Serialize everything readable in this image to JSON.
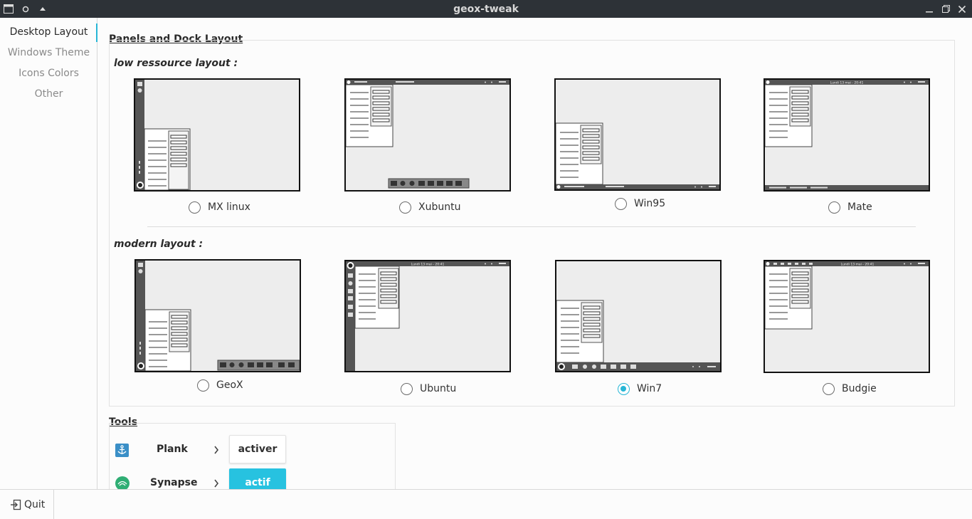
{
  "window": {
    "title": "geox-tweak"
  },
  "sidebar": {
    "items": [
      {
        "label": "Desktop Layout",
        "active": true
      },
      {
        "label": "Windows Theme",
        "active": false
      },
      {
        "label": "Icons Colors",
        "active": false
      },
      {
        "label": "Other",
        "active": false
      }
    ]
  },
  "panels": {
    "title": "Panels and Dock Layout",
    "low_label": "low ressource layout :",
    "modern_label": "modern layout :",
    "low_options": [
      {
        "label": "MX linux",
        "selected": false
      },
      {
        "label": "Xubuntu",
        "selected": false
      },
      {
        "label": "Win95",
        "selected": false
      },
      {
        "label": "Mate",
        "selected": false
      }
    ],
    "modern_options": [
      {
        "label": "GeoX",
        "selected": false
      },
      {
        "label": "Ubuntu",
        "selected": false
      },
      {
        "label": "Win7",
        "selected": true
      },
      {
        "label": "Budgie",
        "selected": false
      }
    ],
    "clock_text": "Lundi 13 mai - 20:41"
  },
  "tools": {
    "title": "Tools",
    "items": [
      {
        "name": "Plank",
        "button": "activer",
        "active": false,
        "icon": "anchor-icon"
      },
      {
        "name": "Synapse",
        "button": "actif",
        "active": true,
        "icon": "synapse-icon"
      }
    ]
  },
  "footer": {
    "quit_label": "Quit"
  },
  "colors": {
    "accent": "#27b6d6",
    "titlebar": "#2d3237",
    "thumb_bg": "#ededed"
  }
}
